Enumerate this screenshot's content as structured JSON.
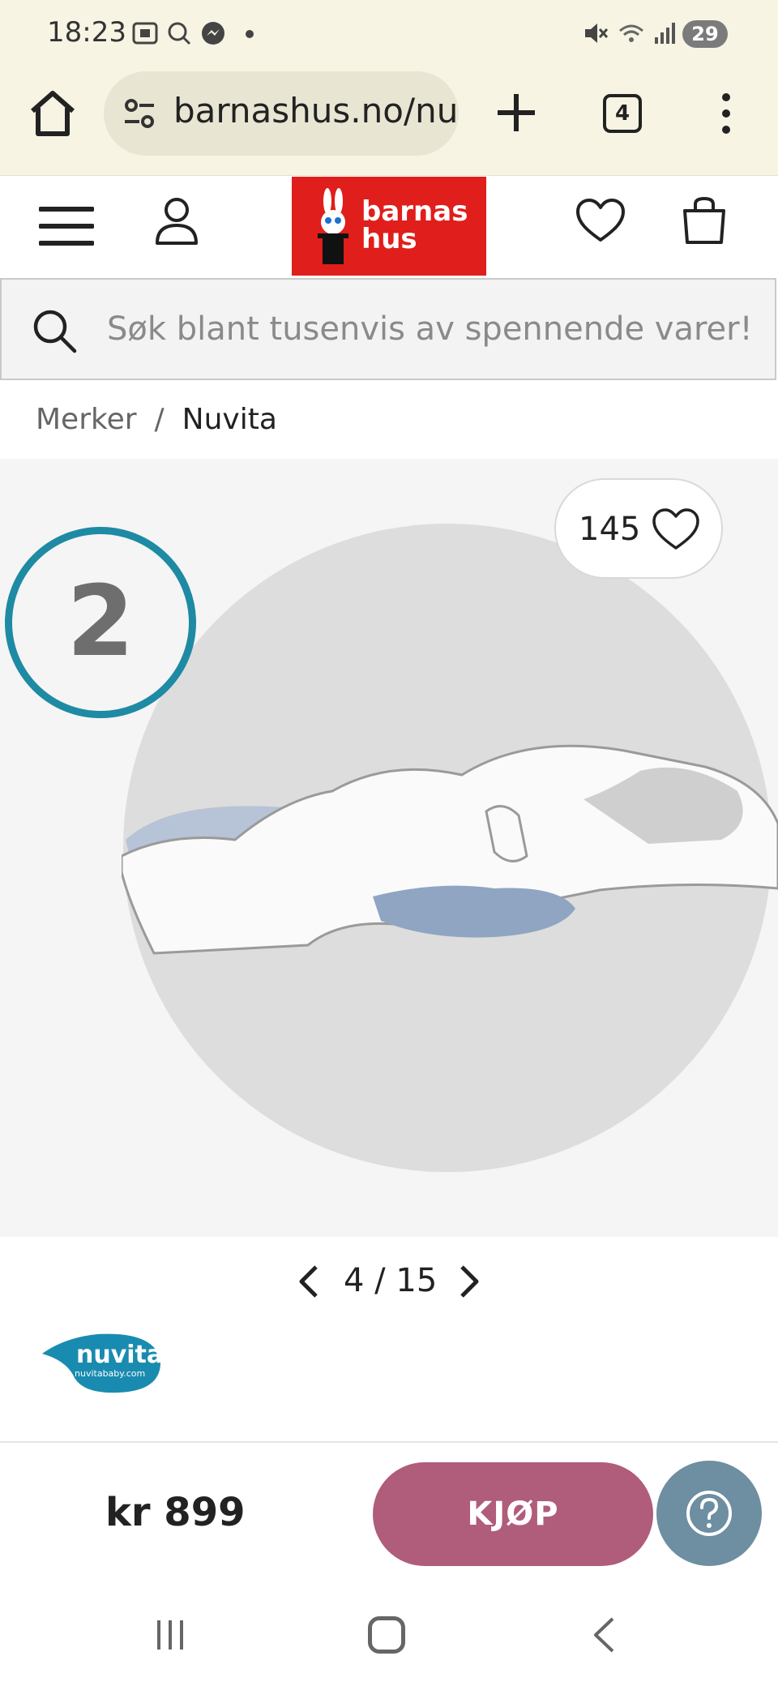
{
  "status_bar": {
    "time": "18:23",
    "battery": "29",
    "icons": [
      "screenshot-icon",
      "search-icon",
      "messenger-icon",
      "dot-icon",
      "mute-icon",
      "wifi-icon",
      "signal-icon"
    ]
  },
  "browser": {
    "url": "barnashus.no/nuvita",
    "tab_count": "4",
    "icons": [
      "home-icon",
      "site-settings-icon",
      "new-tab-icon",
      "tabs-icon",
      "more-vert-icon"
    ]
  },
  "header": {
    "logo_line1": "barnas",
    "logo_line2": "hus",
    "brand_color": "#e01e1b",
    "icons": [
      "menu-icon",
      "account-icon",
      "heart-icon",
      "shopping-bag-icon"
    ]
  },
  "search": {
    "placeholder": "Søk blant tusenvis av spennende varer!"
  },
  "breadcrumb": {
    "items": [
      "Merker",
      "Nuvita"
    ],
    "separator": "/"
  },
  "gallery": {
    "step_number": "2",
    "likes": "145",
    "current": "4",
    "separator": "/",
    "total": "15",
    "accent_color": "#1e8aa4"
  },
  "brand": {
    "name": "nuvita",
    "url": "nuvitababy.com",
    "color": "#1a8bb0"
  },
  "buy_bar": {
    "price": "kr 899",
    "buy_label": "KJØP",
    "buy_color": "#b05c7b",
    "help_color": "#6e8ea1"
  }
}
